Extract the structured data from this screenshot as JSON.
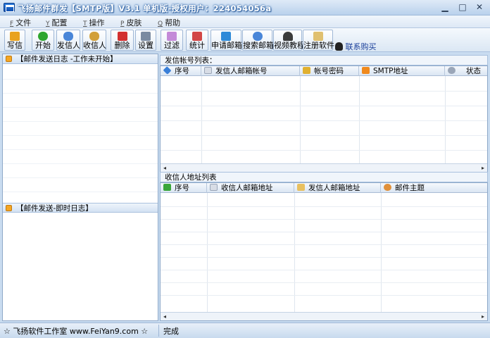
{
  "window": {
    "title": "飞扬邮件群发【SMTP版】V3.1  单机版-授权用户：224054056a",
    "minimize_glyph": "▁",
    "maximize_glyph": "□",
    "close_glyph": "✕"
  },
  "menu": [
    {
      "key": "F",
      "label": "文件"
    },
    {
      "key": "Y",
      "label": "配置"
    },
    {
      "key": "T",
      "label": "操作"
    },
    {
      "key": "P",
      "label": "皮肤"
    },
    {
      "key": "Q",
      "label": "帮助"
    }
  ],
  "toolbar": {
    "write": "写信",
    "start": "开始",
    "sender": "发信人",
    "receiver": "收信人",
    "delete": "删除",
    "settings": "设置",
    "filter": "过滤",
    "stats": "统计",
    "apply_mailbox": "申请邮箱",
    "search_mailbox": "搜索邮箱",
    "video_tutorial": "视频教程",
    "register": "注册软件",
    "buy": "联系购买"
  },
  "left": {
    "send_log_title": "【邮件发送日志 -工作未开始】",
    "live_log_title": "【邮件发送-即时日志】"
  },
  "sender_list": {
    "title": "发信帐号列表：",
    "columns": [
      "序号",
      "发信人邮箱帐号",
      "帐号密码",
      "SMTP地址",
      "状态"
    ]
  },
  "receiver_list": {
    "title": "收信人地址列表",
    "columns": [
      "序号",
      "收信人邮箱地址",
      "发信人邮箱地址",
      "邮件主题"
    ]
  },
  "scroll": {
    "left_arrow": "◂",
    "right_arrow": "▸"
  },
  "status": {
    "company": "☆ 飞扬软件工作室 www.FeiYan9.com ☆",
    "state": "完成"
  },
  "colors": {
    "accent": "#3a6fb0",
    "icon_write": "#e9a21f",
    "icon_start": "#2fa62f",
    "icon_sender": "#4a86d8",
    "icon_receiver": "#d2a03a",
    "icon_delete": "#d23030",
    "icon_settings": "#7a8aa0",
    "icon_filter": "#c48ad8",
    "icon_stats": "#d24646",
    "icon_apply": "#2f8ad8",
    "icon_search": "#4a86d8",
    "icon_video": "#3b3b3b",
    "icon_register": "#e0c070",
    "icon_buy": "#222222"
  }
}
